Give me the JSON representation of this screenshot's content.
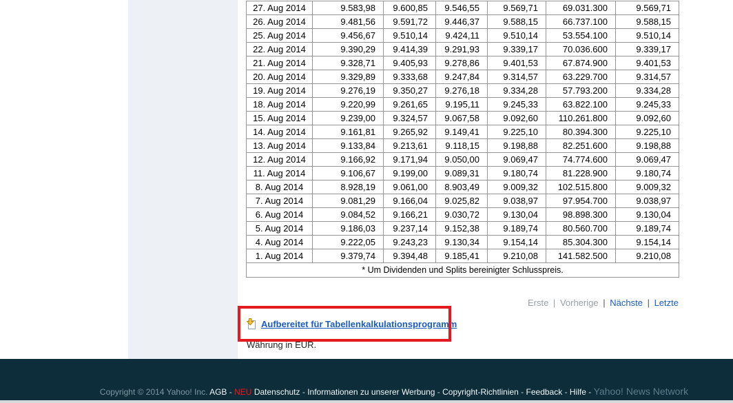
{
  "page": {
    "currency_note": "Währung in EUR."
  },
  "table": {
    "rows": [
      [
        "27. Aug 2014",
        "9.583,98",
        "9.600,85",
        "9.546,55",
        "9.569,71",
        "69.031.300",
        "9.569,71"
      ],
      [
        "26. Aug 2014",
        "9.481,56",
        "9.591,72",
        "9.446,37",
        "9.588,15",
        "66.737.100",
        "9.588,15"
      ],
      [
        "25. Aug 2014",
        "9.456,67",
        "9.510,14",
        "9.424,11",
        "9.510,14",
        "53.554.100",
        "9.510,14"
      ],
      [
        "22. Aug 2014",
        "9.390,29",
        "9.414,39",
        "9.291,93",
        "9.339,17",
        "70.036.600",
        "9.339,17"
      ],
      [
        "21. Aug 2014",
        "9.328,71",
        "9.405,93",
        "9.278,86",
        "9.401,53",
        "67.874.900",
        "9.401,53"
      ],
      [
        "20. Aug 2014",
        "9.329,89",
        "9.333,68",
        "9.247,84",
        "9.314,57",
        "63.229.700",
        "9.314,57"
      ],
      [
        "19. Aug 2014",
        "9.276,19",
        "9.350,27",
        "9.276,18",
        "9.334,28",
        "57.793.200",
        "9.334,28"
      ],
      [
        "18. Aug 2014",
        "9.220,99",
        "9.261,65",
        "9.195,11",
        "9.245,33",
        "63.822.100",
        "9.245,33"
      ],
      [
        "15. Aug 2014",
        "9.239,00",
        "9.324,57",
        "9.067,58",
        "9.092,60",
        "110.261.800",
        "9.092,60"
      ],
      [
        "14. Aug 2014",
        "9.161,81",
        "9.265,92",
        "9.149,41",
        "9.225,10",
        "80.394.300",
        "9.225,10"
      ],
      [
        "13. Aug 2014",
        "9.133,84",
        "9.213,61",
        "9.118,15",
        "9.198,88",
        "82.251.600",
        "9.198,88"
      ],
      [
        "12. Aug 2014",
        "9.166,92",
        "9.171,94",
        "9.050,00",
        "9.069,47",
        "74.774.600",
        "9.069,47"
      ],
      [
        "11. Aug 2014",
        "9.106,67",
        "9.199,00",
        "9.089,31",
        "9.180,74",
        "81.228.900",
        "9.180,74"
      ],
      [
        "8. Aug 2014",
        "8.928,19",
        "9.061,00",
        "8.903,49",
        "9.009,32",
        "102.515.800",
        "9.009,32"
      ],
      [
        "7. Aug 2014",
        "9.081,29",
        "9.166,04",
        "9.025,82",
        "9.038,97",
        "97.954.700",
        "9.038,97"
      ],
      [
        "6. Aug 2014",
        "9.084,52",
        "9.166,21",
        "9.030,72",
        "9.130,04",
        "98.898.300",
        "9.130,04"
      ],
      [
        "5. Aug 2014",
        "9.186,03",
        "9.237,14",
        "9.152,38",
        "9.189,74",
        "80.560.700",
        "9.189,74"
      ],
      [
        "4. Aug 2014",
        "9.222,05",
        "9.243,23",
        "9.130,34",
        "9.154,14",
        "85.304.300",
        "9.154,14"
      ],
      [
        "1. Aug 2014",
        "9.379,74",
        "9.394,48",
        "9.185,41",
        "9.210,08",
        "141.582.500",
        "9.210,08"
      ]
    ],
    "footnote": "* Um Dividenden und Splits bereinigter Schlusspreis."
  },
  "pagination": {
    "first": "Erste",
    "previous": "Vorherige",
    "next": "Nächste",
    "last": "Letzte",
    "separator": "|"
  },
  "download": {
    "label": "Aufbereitet für Tabellenkalkulationsprogramm"
  },
  "footer": {
    "copyright": "Copyright © 2014 Yahoo! Inc.",
    "links": [
      "AGB",
      "Datenschutz",
      "Informationen zu unserer Werbung",
      "Copyright-Richtlinien",
      "Feedback",
      "Hilfe"
    ],
    "new_badge": "NEU",
    "separator": "-",
    "network": "Yahoo! News Network"
  },
  "colors": {
    "highlight_red": "#e31b21",
    "link_blue": "#1a5cc0",
    "footer_bg": "#0d2d3a",
    "new_badge_red": "#ff1111",
    "sidebar_bg": "#edf1f6",
    "table_border": "#969696"
  }
}
